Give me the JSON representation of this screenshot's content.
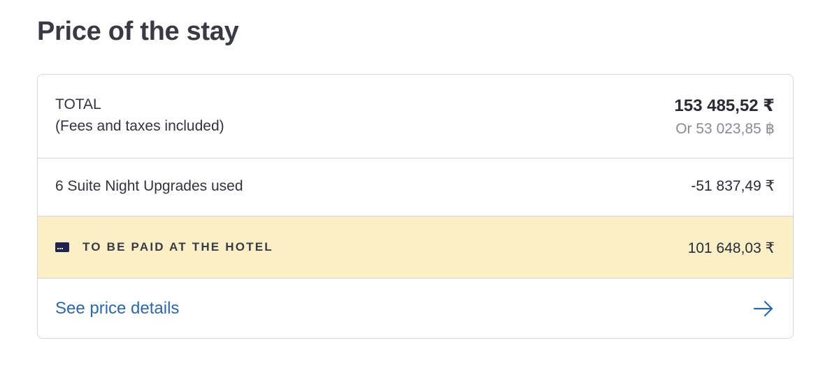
{
  "page": {
    "title": "Price of the stay"
  },
  "total": {
    "label": "TOTAL",
    "sublabel": "(Fees and taxes included)",
    "amount": "153 485,52 ₹",
    "alt_amount": "Or 53 023,85 ฿"
  },
  "upgrades": {
    "label": "6 Suite Night Upgrades used",
    "amount": "-51 837,49 ₹"
  },
  "hotel": {
    "icon": "credit-card-icon",
    "label": "TO BE PAID AT THE HOTEL",
    "amount": "101 648,03 ₹",
    "background": "#fbefc8"
  },
  "details": {
    "link_label": "See price details",
    "icon": "arrow-right-icon",
    "link_color": "#2f68a6"
  }
}
